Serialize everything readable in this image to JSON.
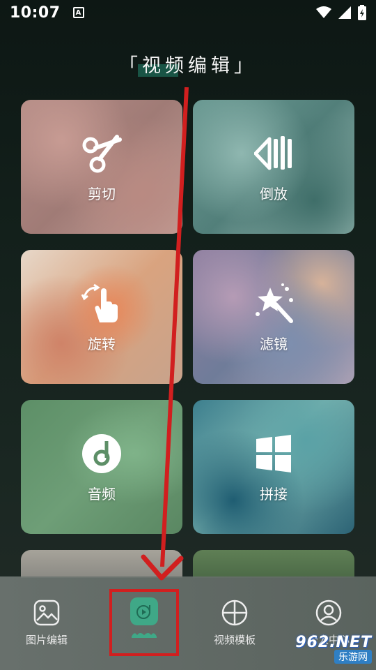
{
  "status_bar": {
    "time": "10:07",
    "notif_letter": "A"
  },
  "page": {
    "title": "「视频编辑」"
  },
  "cards": [
    {
      "label": "剪切",
      "icon": "scissors-icon"
    },
    {
      "label": "倒放",
      "icon": "rewind-icon"
    },
    {
      "label": "旋转",
      "icon": "rotate-hand-icon"
    },
    {
      "label": "滤镜",
      "icon": "magic-wand-icon"
    },
    {
      "label": "音频",
      "icon": "music-disc-icon"
    },
    {
      "label": "拼接",
      "icon": "grid-icon"
    }
  ],
  "bottom_nav": {
    "items": [
      {
        "label": "图片编辑",
        "icon": "image-icon",
        "active": false
      },
      {
        "label": "",
        "icon": "video-play-icon",
        "active": true
      },
      {
        "label": "视频模板",
        "icon": "template-icon",
        "active": false
      },
      {
        "label": "个人中心",
        "icon": "user-icon",
        "active": false
      }
    ]
  },
  "watermark": {
    "top": "962.NET",
    "bottom": "乐游网"
  },
  "colors": {
    "accent": "#3fa887",
    "annotation_red": "#d11f1f"
  }
}
